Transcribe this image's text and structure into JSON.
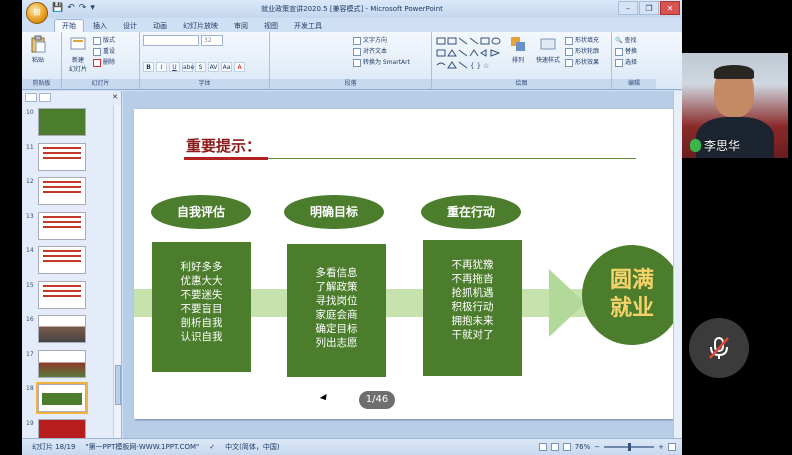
{
  "window": {
    "title": "就业政策宣讲2020.5 [兼容模式] - Microsoft PowerPoint",
    "office_button": "⊞",
    "qat": [
      "💾",
      "↶",
      "↷",
      "▾"
    ],
    "controls": [
      "–",
      "❐",
      "✕"
    ]
  },
  "ribbon": {
    "tabs": [
      "开始",
      "插入",
      "设计",
      "动画",
      "幻灯片放映",
      "审阅",
      "视图",
      "开发工具"
    ],
    "active_tab": "开始",
    "groups": {
      "clipboard": {
        "label": "剪贴板",
        "paste": "粘贴"
      },
      "slides": {
        "label": "幻灯片",
        "new_slide": "新建\n幻灯片",
        "layout": "版式",
        "reset": "重设",
        "delete": "删除"
      },
      "font": {
        "label": "字体",
        "font_name": "",
        "font_size": "32",
        "buttons": [
          "B",
          "I",
          "U",
          "abe",
          "S",
          "AV",
          "Aa",
          "A"
        ]
      },
      "paragraph": {
        "label": "段落",
        "text_direction": "文字方向",
        "align_text": "对齐文本",
        "smartart": "转换为 SmartArt"
      },
      "drawing": {
        "label": "绘图",
        "arrange": "排列",
        "quick_styles": "快速样式",
        "shape_fill": "形状填充",
        "shape_outline": "形状轮廓",
        "shape_effects": "形状效果"
      },
      "editing": {
        "label": "编辑",
        "find": "查找",
        "replace": "替换",
        "select": "选择"
      }
    }
  },
  "slide_pane": {
    "items": [
      {
        "num": "10"
      },
      {
        "num": "11"
      },
      {
        "num": "12"
      },
      {
        "num": "13"
      },
      {
        "num": "14"
      },
      {
        "num": "15"
      },
      {
        "num": "16"
      },
      {
        "num": "17"
      },
      {
        "num": "18"
      },
      {
        "num": "19"
      }
    ],
    "selected": "18"
  },
  "slide": {
    "title": "重要提示：",
    "columns": [
      {
        "heading": "自我评估",
        "lines": [
          "利好多多",
          "优惠大大",
          "不要迷失",
          "不要盲目",
          "剖析自我",
          "认识自我"
        ]
      },
      {
        "heading": "明确目标",
        "lines": [
          "多看信息",
          "了解政策",
          "寻找岗位",
          "家庭会商",
          "确定目标",
          "列出志愿"
        ]
      },
      {
        "heading": "重在行动",
        "lines": [
          "不再犹豫",
          "不再拖沓",
          "抢抓机遇",
          "积极行动",
          "拥抱未来",
          "干就对了"
        ]
      }
    ],
    "result": [
      "圆满",
      "就业"
    ],
    "page_counter": "1/46"
  },
  "statusbar": {
    "slide_info": "幻灯片 18/19",
    "theme": "\"第一PPT模板网-WWW.1PPT.COM\"",
    "language": "中文(简体，中国)",
    "zoom": "76%"
  },
  "meeting": {
    "participant_name": "李思华"
  },
  "colors": {
    "accent_green": "#4b7d2d",
    "light_green": "#c6e3ae",
    "title_red": "#8a1a1a",
    "gold_text": "#f5d36a"
  }
}
